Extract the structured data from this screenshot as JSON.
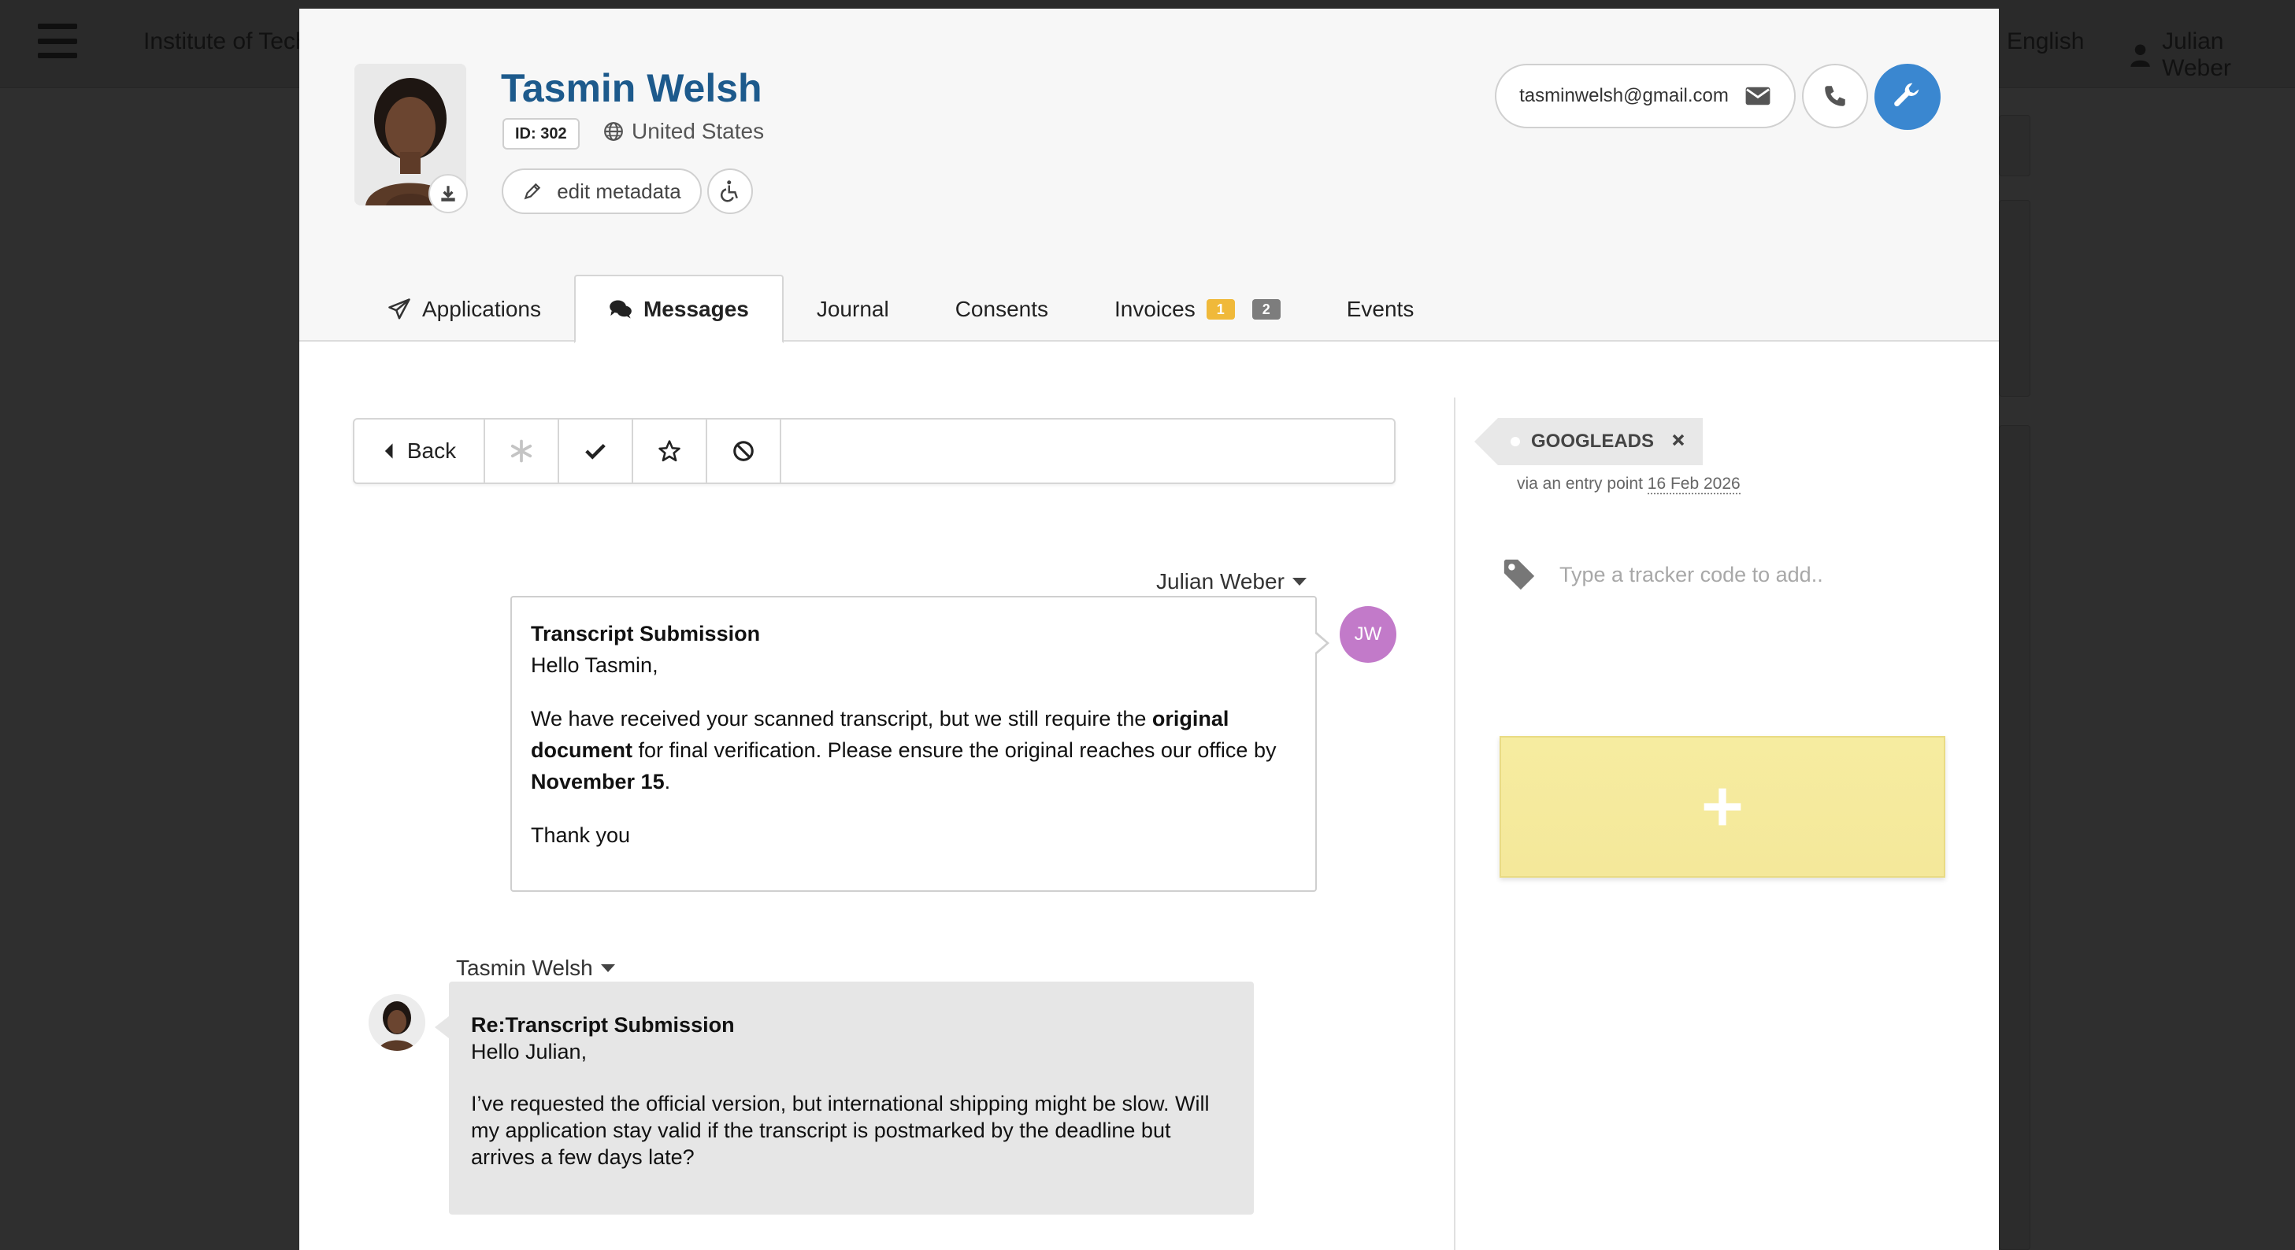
{
  "background": {
    "org_name": "Institute of Tech",
    "language": "English",
    "user_name": "Julian Weber"
  },
  "profile": {
    "name": "Tasmin Welsh",
    "id_label": "ID: 302",
    "country": "United States",
    "edit_metadata_label": "edit metadata",
    "email": "tasminwelsh@gmail.com"
  },
  "tabs": [
    {
      "label": "Applications",
      "icon": "paper-plane-icon",
      "active": false
    },
    {
      "label": "Messages",
      "icon": "comments-icon",
      "active": true
    },
    {
      "label": "Journal",
      "active": false
    },
    {
      "label": "Consents",
      "active": false
    },
    {
      "label": "Invoices",
      "active": false,
      "badges": [
        "1",
        "2"
      ]
    },
    {
      "label": "Events",
      "active": false
    }
  ],
  "toolbar": {
    "back_label": "Back",
    "icons": [
      "asterisk-icon",
      "check-icon",
      "star-icon",
      "ban-icon"
    ]
  },
  "messages": [
    {
      "sender": "Julian Weber",
      "initials": "JW",
      "subject": "Transcript Submission",
      "greeting": "Hello Tasmin,",
      "body_part1": "We have received your scanned transcript, but we still require the ",
      "body_bold1": "original document",
      "body_part2": " for final verification. Please ensure the original reaches our office by ",
      "body_bold2": "November 15",
      "body_part3": ".",
      "closing": "Thank you"
    },
    {
      "sender": "Tasmin Welsh",
      "subject": "Re:Transcript Submission",
      "greeting": "Hello Julian,",
      "body": "I’ve requested the official version, but international shipping might be slow. Will my application stay valid if the transcript is postmarked by the deadline but arrives a few days late?"
    }
  ],
  "tracker": {
    "tag_label": "GOOGLEADS",
    "via_text": "via an entry point",
    "via_date": "16 Feb 2026",
    "input_placeholder": "Type a tracker code to add.."
  },
  "colors": {
    "name_blue": "#1d5a8c",
    "accent_blue": "#3a87d0",
    "jw_avatar": "#c27ac9",
    "badge_yellow": "#f0b93a",
    "badge_gray": "#7d7d7d",
    "note_yellow": "#f4e89a"
  }
}
